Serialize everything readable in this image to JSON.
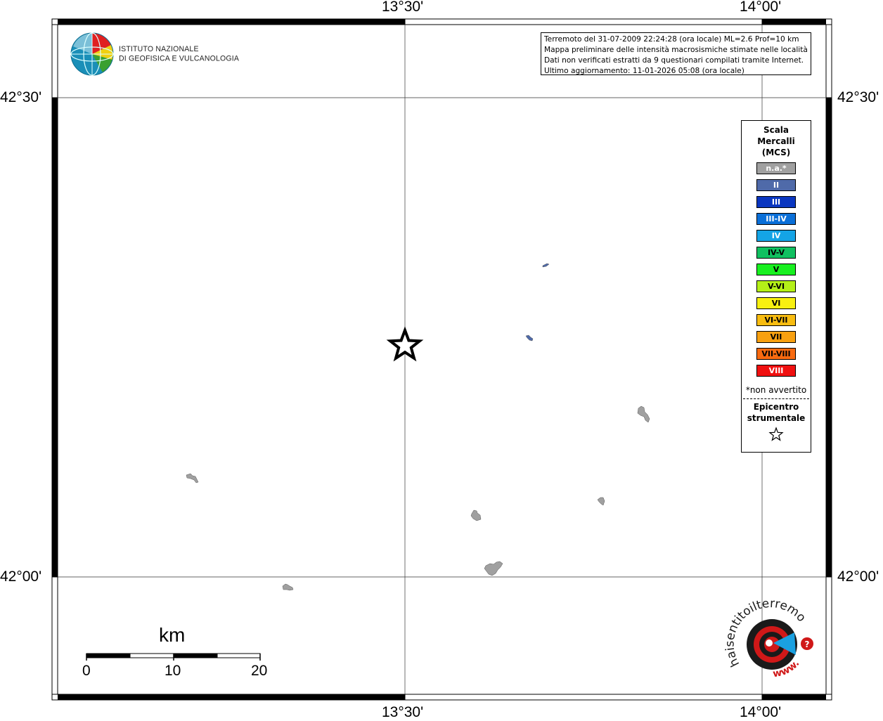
{
  "map": {
    "lon_labels": [
      "13°30'",
      "14°00'"
    ],
    "lat_labels": [
      "42°30'",
      "42°00'"
    ]
  },
  "info": {
    "line1": "Terremoto del 31-07-2009 22:24:28 (ora locale) ML=2.6 Prof=10 km",
    "line2": "Mappa preliminare delle intensità macrosismiche stimate nelle località",
    "line3": "Dati non verificati estratti da 9 questionari compilati tramite Internet.",
    "line4": "Ultimo aggiornamento: 11-01-2026 05:08 (ora locale)"
  },
  "logo_ingv": {
    "line1": "ISTITUTO NAZIONALE",
    "line2": "DI GEOFISICA E VULCANOLOGIA"
  },
  "legend": {
    "title": "Scala Mercalli (MCS)",
    "items": [
      {
        "label": "n.a.*",
        "color": "#a0a0a0",
        "text_color": "#ffffff"
      },
      {
        "label": "II",
        "color": "#4f6aa9",
        "text_color": "#ffffff"
      },
      {
        "label": "III",
        "color": "#0a36c0",
        "text_color": "#ffffff"
      },
      {
        "label": "III-IV",
        "color": "#0a6fd8",
        "text_color": "#ffffff"
      },
      {
        "label": "IV",
        "color": "#14a4e6",
        "text_color": "#ffffff"
      },
      {
        "label": "IV-V",
        "color": "#10c060",
        "text_color": "#000000"
      },
      {
        "label": "V",
        "color": "#18f020",
        "text_color": "#000000"
      },
      {
        "label": "V-VI",
        "color": "#b4f018",
        "text_color": "#000000"
      },
      {
        "label": "VI",
        "color": "#f8f010",
        "text_color": "#000000"
      },
      {
        "label": "VI-VII",
        "color": "#f8bc10",
        "text_color": "#000000"
      },
      {
        "label": "VII",
        "color": "#f8a010",
        "text_color": "#000000"
      },
      {
        "label": "VII-VIII",
        "color": "#f86a10",
        "text_color": "#000000"
      },
      {
        "label": "VIII",
        "color": "#f01010",
        "text_color": "#ffffff"
      }
    ],
    "note": "*non avvertito",
    "epicenter_label": "Epicentro strumentale"
  },
  "scalebar": {
    "unit": "km",
    "ticks": [
      "0",
      "10",
      "20"
    ]
  },
  "locality_colors": {
    "not_felt": "#a0a0a0",
    "intensity_II": "#4f6aa9"
  },
  "haisentito_logo": {
    "text_top": "haisentitoilterremoto.it",
    "text_bottom": "www."
  }
}
